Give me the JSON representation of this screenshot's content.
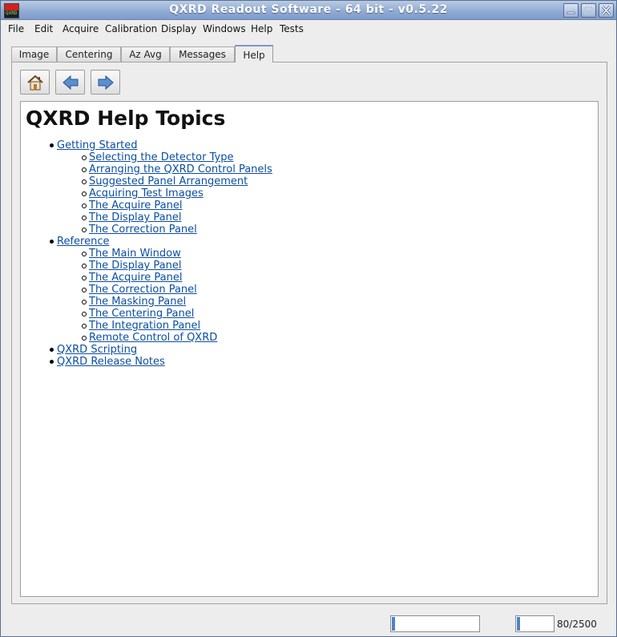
{
  "window": {
    "title": "QXRD Readout Software - 64 bit - v0.5.22",
    "app_icon_text": "QXRD"
  },
  "menubar": [
    "File",
    "Edit",
    "Acquire",
    "Calibration",
    "Display",
    "Windows",
    "Help",
    "Tests"
  ],
  "tabs": [
    "Image",
    "Centering",
    "Az Avg",
    "Messages",
    "Help"
  ],
  "active_tab": "Help",
  "nav": {
    "home": "home-icon",
    "back": "back-arrow-icon",
    "forward": "forward-arrow-icon"
  },
  "help": {
    "heading": "QXRD Help Topics",
    "topics": [
      {
        "label": "Getting Started",
        "children": [
          "Selecting the Detector Type",
          "Arranging the QXRD Control Panels",
          "Suggested Panel Arrangement",
          "Acquiring Test Images",
          "The Acquire Panel",
          "The Display Panel",
          "The Correction Panel"
        ]
      },
      {
        "label": "Reference",
        "children": [
          "The Main Window",
          "The Display Panel",
          "The Acquire Panel",
          "The Correction Panel",
          "The Masking Panel",
          "The Centering Panel",
          "The Integration Panel",
          "Remote Control of QXRD"
        ]
      },
      {
        "label": "QXRD Scripting",
        "children": []
      },
      {
        "label": "QXRD Release Notes",
        "children": []
      }
    ]
  },
  "status": {
    "progress1": 0.01,
    "progress2": 0.01,
    "counter": "80/2500"
  },
  "colors": {
    "link": "#0b4ea2",
    "titlebar": "#8ea9d2",
    "progress_fill": "#4e82c9"
  }
}
